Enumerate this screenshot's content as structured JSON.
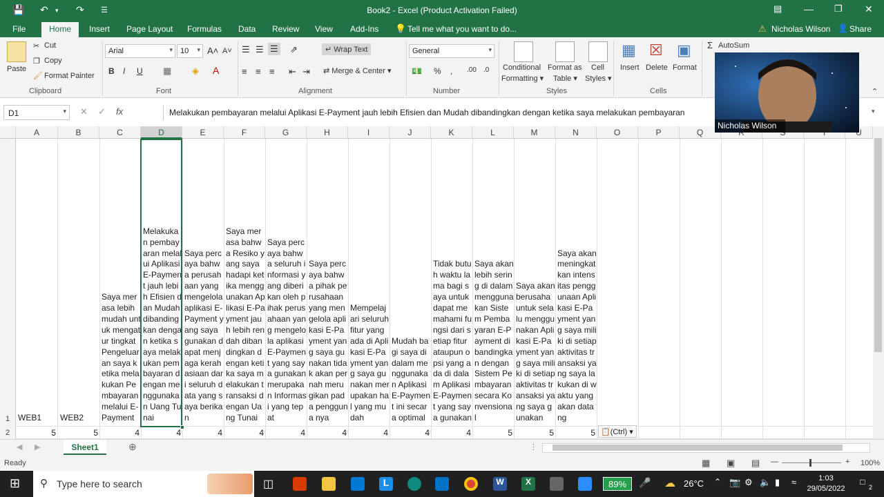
{
  "window": {
    "title": "Book2 - Excel (Product Activation Failed)"
  },
  "tabs": [
    "File",
    "Home",
    "Insert",
    "Page Layout",
    "Formulas",
    "Data",
    "Review",
    "View",
    "Add-Ins"
  ],
  "tell_me": "Tell me what you want to do...",
  "user_name": "Nicholas Wilson",
  "share_label": "Share",
  "ribbon": {
    "clipboard": {
      "paste": "Paste",
      "cut": "Cut",
      "copy": "Copy",
      "format_painter": "Format Painter",
      "label": "Clipboard"
    },
    "font": {
      "name": "Arial",
      "size": "10",
      "label": "Font",
      "bold": "B",
      "italic": "I",
      "underline": "U"
    },
    "alignment": {
      "wrap_text": "Wrap Text",
      "merge_center": "Merge & Center",
      "label": "Alignment"
    },
    "number": {
      "format": "General",
      "label": "Number"
    },
    "styles": {
      "conditional": "Conditional",
      "conditional2": "Formatting",
      "format_as": "Format as",
      "table": "Table",
      "cell": "Cell",
      "styles2": "Styles",
      "label": "Styles"
    },
    "cells": {
      "insert": "Insert",
      "delete": "Delete",
      "format": "Format",
      "label": "Cells"
    },
    "editing": {
      "autosum": "AutoSum"
    }
  },
  "formula_bar": {
    "name_box": "D1",
    "content": "Melakukan pembayaran melalui Aplikasi E-Payment jauh lebih Efisien dan Mudah dibandingkan dengan ketika saya melakukan pembayaran"
  },
  "grid": {
    "columns": [
      "A",
      "B",
      "C",
      "D",
      "E",
      "F",
      "G",
      "H",
      "I",
      "J",
      "K",
      "L",
      "M",
      "N",
      "O",
      "P",
      "Q",
      "R",
      "S",
      "T",
      "U"
    ],
    "rows": [
      "1",
      "2"
    ],
    "row1": {
      "A": "WEB1",
      "B": "WEB2",
      "C": "Saya merasa lebih mudah untuk mengatur tingkat Pengeluaran saya ketika melakukan Pembayaran melalui E-Payment",
      "D": "Melakukan pembayaran melalui Aplikasi E-Payment jauh lebih Efisien dan Mudah dibandingkan dengan ketika saya melakukan pembayaran dengan menggunakan Uang Tunai",
      "E": "Saya percaya bahwa perusahaan yang mengelola aplikasi E-Payment yang saya gunakan dapat menjaga kerahasiaan dari seluruh data yang saya berikan",
      "F": "Saya merasa bahwa Resiko yang saya hadapi ketika menggunakan Aplikasi E-Payment jauh lebih rendah dibandingkan dengan ketika saya melakukan transaksi dengan Uang Tunai",
      "G": "Saya percaya bahwa seluruh informasi yang diberikan oleh pihak perusahaan yang mengelola aplikasi E-Payment yang saya gunakan merupakan Informasi yang tepat",
      "H": "Saya percaya bahwa pihak perusahaan yang mengelola aplikasi E-Payment yang saya gunakan tidak akan pernah merugikan pada pengguna nya",
      "I": "Mempelajari seluruh fitur yang ada di Aplikasi E-Payment yang saya gunakan merupakan hal yang mudah",
      "J": "Mudah bagi saya di dalam menggunakan Aplikasi E-Payment ini secara optimal",
      "K": "Tidak butuh waktu lama bagi saya untuk dapat memahami fungsi dari setiap fitur ataupun opsi yang ada di dalam Aplikasi E-Payment yang saya gunakan",
      "L": "Saya akan lebih sering di dalam menggunakan Sistem Pembayaran E-Payment dibandingkan dengan Sistem Pembayaran secara Konvensional",
      "M": "Saya akan berusaha untuk selalu menggunakan Aplikasi E-Payment yang saya miliki di setiap aktivitas transaksi yang saya gunakan",
      "N": "Saya akan meningkatkan intensitas penggunaan Aplikasi E-Payment yang saya miliki di setiap aktivitas transaksi yang saya lakukan di waktu yang akan datang"
    },
    "row2": {
      "A": "5",
      "B": "5",
      "C": "4",
      "D": "4",
      "E": "4",
      "F": "4",
      "G": "4",
      "H": "4",
      "I": "4",
      "J": "4",
      "K": "4",
      "L": "5",
      "M": "5",
      "N": "5"
    },
    "paste_options": "(Ctrl)"
  },
  "sheets": [
    "Sheet1"
  ],
  "status": {
    "ready": "Ready",
    "zoom": "100%"
  },
  "taskbar": {
    "search_placeholder": "Type here to search",
    "battery": "89%",
    "temperature": "26°C",
    "time": "1:03",
    "date": "29/05/2022",
    "notifications": "2"
  },
  "video_overlay": {
    "name": "Nicholas Wilson"
  },
  "colors": {
    "accent": "#217346",
    "taskbar": "#202020"
  }
}
